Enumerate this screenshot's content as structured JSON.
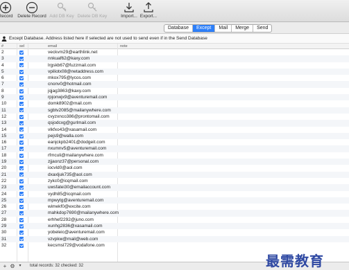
{
  "toolbar": {
    "buttons": [
      {
        "label": "Record",
        "icon": "plus-circle-icon",
        "enabled": true
      },
      {
        "label": "Delete Record",
        "icon": "minus-circle-icon",
        "enabled": true
      },
      {
        "label": "Add DB Key",
        "icon": "add-key-icon",
        "enabled": false
      },
      {
        "label": "Delete DB Key",
        "icon": "delete-key-icon",
        "enabled": false
      },
      {
        "label": "Import...",
        "icon": "import-icon",
        "enabled": true
      },
      {
        "label": "Export...",
        "icon": "export-icon",
        "enabled": true
      }
    ]
  },
  "tabs": {
    "items": [
      "Database",
      "Except",
      "Mail",
      "Merge",
      "Send"
    ],
    "active": "Except"
  },
  "info": {
    "text": "Except Database. Address listed here if selected are not used to send even if in the Send Database"
  },
  "table": {
    "columns": {
      "number": "#",
      "selected": "sel",
      "email": "email",
      "note": "note"
    },
    "rows": [
      {
        "n": "2",
        "email": "veckvm29@earthlink.net"
      },
      {
        "n": "3",
        "email": "nnkuaf62@kaxy.com"
      },
      {
        "n": "4",
        "email": "lrgskb67@fuzzmail.com"
      },
      {
        "n": "5",
        "email": "vpiliotx08@netaddress.com"
      },
      {
        "n": "6",
        "email": "mkox795@lycos.com"
      },
      {
        "n": "7",
        "email": "cnonv0@hotmail.com"
      },
      {
        "n": "8",
        "email": "jqjag3863@kaxy.com"
      },
      {
        "n": "9",
        "email": "rpjonwjx9@aventuremail.com"
      },
      {
        "n": "10",
        "email": "domk8902@mail.com"
      },
      {
        "n": "11",
        "email": "sgbtv2085@mailanywhere.com"
      },
      {
        "n": "12",
        "email": "cvyzxnco386@prontomail.com"
      },
      {
        "n": "13",
        "email": "qsjodcxg@gurlmail.com"
      },
      {
        "n": "14",
        "email": "vlkfxo43@xasamail.com"
      },
      {
        "n": "15",
        "email": "pejs9@walla.com"
      },
      {
        "n": "16",
        "email": "eanjckpb2401@dodgeit.com"
      },
      {
        "n": "17",
        "email": "nxumnv5@aventuremail.com"
      },
      {
        "n": "18",
        "email": "rfmculi@mailanywhere.com"
      },
      {
        "n": "19",
        "email": "zjjaonz37@personal.com"
      },
      {
        "n": "20",
        "email": "iocvld0@aol.com"
      },
      {
        "n": "21",
        "email": "dxaxljuk735@aol.com"
      },
      {
        "n": "22",
        "email": "zykc0@icqmail.com"
      },
      {
        "n": "23",
        "email": "uwsfatei30@emailaccount.com"
      },
      {
        "n": "24",
        "email": "vydh85@icqmail.com"
      },
      {
        "n": "25",
        "email": "mpwytg@aventuremail.com"
      },
      {
        "n": "26",
        "email": "wimekf0@excite.com"
      },
      {
        "n": "27",
        "email": "mahkdop7690@mailanywhere.com"
      },
      {
        "n": "28",
        "email": "erhhef2292@juno.com"
      },
      {
        "n": "29",
        "email": "xunhg2836@xasamail.com"
      },
      {
        "n": "30",
        "email": "yobeleic@aventuremail.com"
      },
      {
        "n": "31",
        "email": "vzvpkw@mail@web.com"
      },
      {
        "n": "32",
        "email": "kecsmsl729@vodafone.com"
      }
    ]
  },
  "status": {
    "text": "total records: 32 checked: 32",
    "add_symbol": "+",
    "gear_symbol": "⚙"
  },
  "watermark": {
    "text": "最需教育"
  },
  "colors": {
    "accent": "#2d7ff9",
    "watermark": "#1f3b9c"
  }
}
